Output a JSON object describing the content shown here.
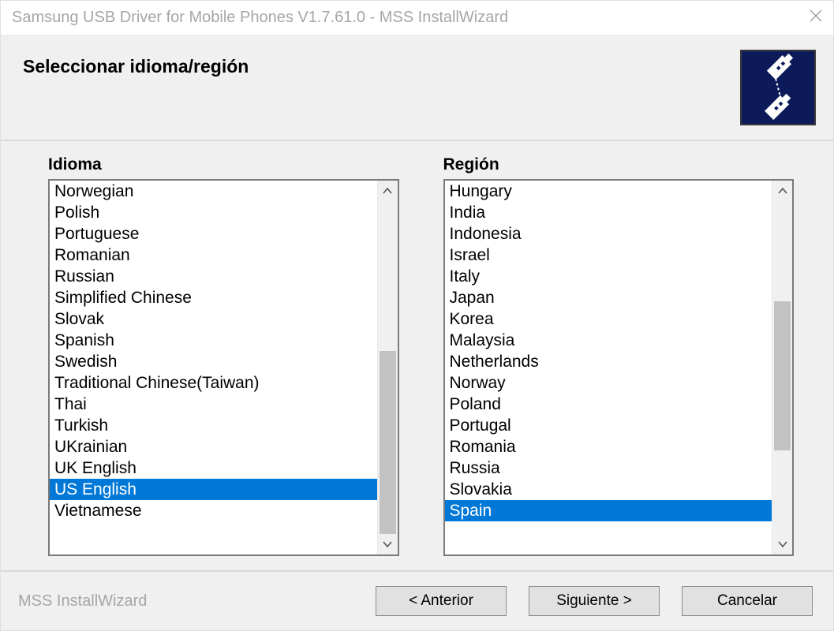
{
  "titlebar": {
    "title": "Samsung USB Driver for Mobile Phones V1.7.61.0 - MSS InstallWizard"
  },
  "header": {
    "title": "Seleccionar idioma/región"
  },
  "labels": {
    "language": "Idioma",
    "region": "Región"
  },
  "language": {
    "items": [
      "Norwegian",
      "Polish",
      "Portuguese",
      "Romanian",
      "Russian",
      "Simplified Chinese",
      "Slovak",
      "Spanish",
      "Swedish",
      "Traditional Chinese(Taiwan)",
      "Thai",
      "Turkish",
      "UKrainian",
      "UK English",
      "US English",
      "Vietnamese"
    ],
    "selected_index": 14
  },
  "region": {
    "items": [
      "Hungary",
      "India",
      "Indonesia",
      "Israel",
      "Italy",
      "Japan",
      "Korea",
      "Malaysia",
      "Netherlands",
      "Norway",
      "Poland",
      "Portugal",
      "Romania",
      "Russia",
      "Slovakia",
      "Spain"
    ],
    "selected_index": 15
  },
  "footer": {
    "brand": "MSS InstallWizard",
    "back": "< Anterior",
    "next": "Siguiente >",
    "cancel": "Cancelar"
  }
}
